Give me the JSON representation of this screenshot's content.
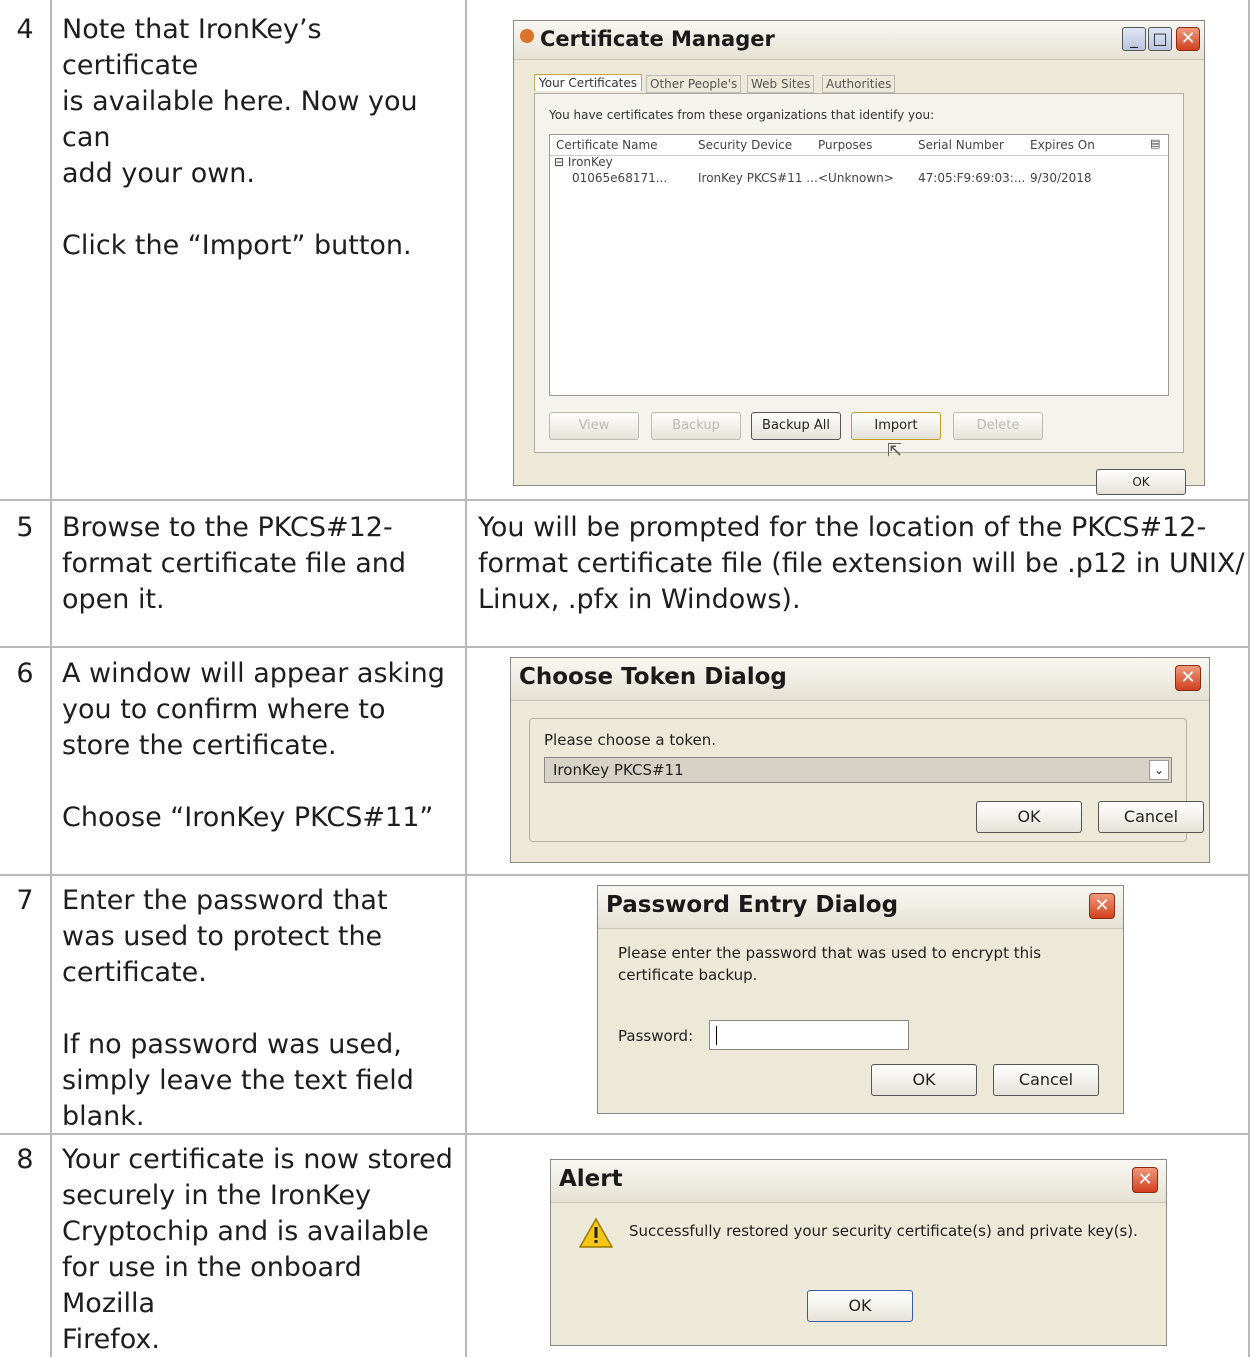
{
  "steps": [
    {
      "num": "4",
      "lines": [
        "Note that IronKey’s certificate",
        "is available here. Now you can",
        "add your own."
      ],
      "lines2": [
        "Click the “Import” button."
      ]
    },
    {
      "num": "5",
      "lines": [
        "Browse to the PKCS#12-",
        "format certificate file and",
        "open it."
      ],
      "right_lines": [
        "You will be prompted for the location of the PKCS#12-",
        "format certificate file (file extension will be .p12 in UNIX/",
        "Linux, .pfx in Windows)."
      ]
    },
    {
      "num": "6",
      "lines": [
        "A window will appear asking",
        "you to confirm where to",
        "store the certificate."
      ],
      "lines2": [
        "Choose “IronKey PKCS#11”"
      ]
    },
    {
      "num": "7",
      "lines": [
        "Enter the password that",
        "was used to protect the",
        "certificate."
      ],
      "lines2": [
        "If no password was used,",
        "simply leave the text field",
        "blank."
      ]
    },
    {
      "num": "8",
      "lines": [
        "Your certificate is now stored",
        "securely in the IronKey",
        "Cryptochip and is available",
        "for use in the onboard Mozilla",
        "Firefox."
      ]
    }
  ],
  "cert_manager": {
    "title": "Certificate Manager",
    "tabs": [
      "Your Certificates",
      "Other People's",
      "Web Sites",
      "Authorities"
    ],
    "intro": "You have certificates from these organizations that identify you:",
    "columns": [
      "Certificate Name",
      "Security Device",
      "Purposes",
      "Serial Number",
      "Expires On"
    ],
    "group": "IronKey",
    "row": [
      "01065e68171...",
      "IronKey PKCS#11 ...",
      "<Unknown>",
      "47:05:F9:69:03:...",
      "9/30/2018"
    ],
    "buttons": [
      "View",
      "Backup",
      "Backup All",
      "Import",
      "Delete"
    ],
    "ok": "OK"
  },
  "token_dialog": {
    "title": "Choose Token Dialog",
    "prompt": "Please choose a token.",
    "selected": "IronKey PKCS#11",
    "ok": "OK",
    "cancel": "Cancel"
  },
  "password_dialog": {
    "title": "Password Entry Dialog",
    "line1": "Please enter the password that was used to encrypt this",
    "line2": "certificate backup.",
    "label": "Password:",
    "ok": "OK",
    "cancel": "Cancel"
  },
  "alert_dialog": {
    "title": "Alert",
    "message": "Successfully restored your security certificate(s) and private key(s).",
    "ok": "OK"
  }
}
